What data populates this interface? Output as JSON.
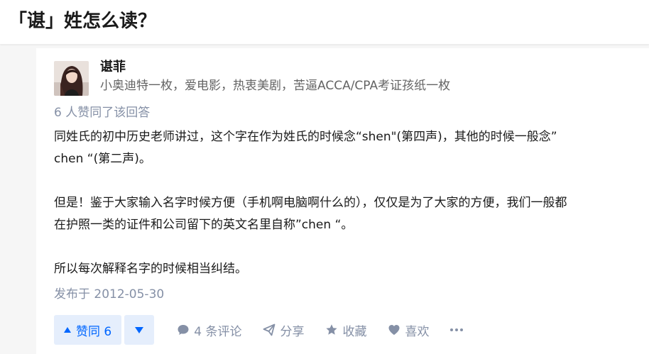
{
  "question": {
    "title": "「谌」姓怎么读？"
  },
  "answer": {
    "author": {
      "name": "谌菲",
      "bio": "小奥迪特一枚，爱电影，热衷美剧，苦逼ACCA/CPA考证孩纸一枚"
    },
    "vote_summary": "6 人赞同了该回答",
    "paragraphs": [
      "同姓氏的初中历史老师讲过，这个字在作为姓氏的时候念“shen\"(第四声)，其他的时候一般念”",
      "chen “(第二声)。",
      "但是！鉴于大家输入名字时候方便（手机啊电脑啊什么的），仅仅是为了大家的方便，我们一般都",
      "在护照一类的证件和公司留下的英文名里自称”chen “。",
      "所以每次解释名字的时候相当纠结。"
    ],
    "published": "发布于 2012-05-30",
    "actions": {
      "vote_up_label": "赞同 6",
      "comment_label": "4 条评论",
      "share_label": "分享",
      "collect_label": "收藏",
      "like_label": "喜欢"
    }
  },
  "icons": {
    "vote_up": "triangle-up-icon",
    "vote_down": "triangle-down-icon",
    "comment": "comment-bubble-icon",
    "share": "paper-plane-icon",
    "collect": "star-icon",
    "like": "heart-icon",
    "more": "ellipsis-icon"
  },
  "colors": {
    "accent_blue": "#0066ff",
    "vote_bg": "#e5eefc",
    "meta_gray": "#8590a6",
    "bio_gray": "#646464"
  }
}
